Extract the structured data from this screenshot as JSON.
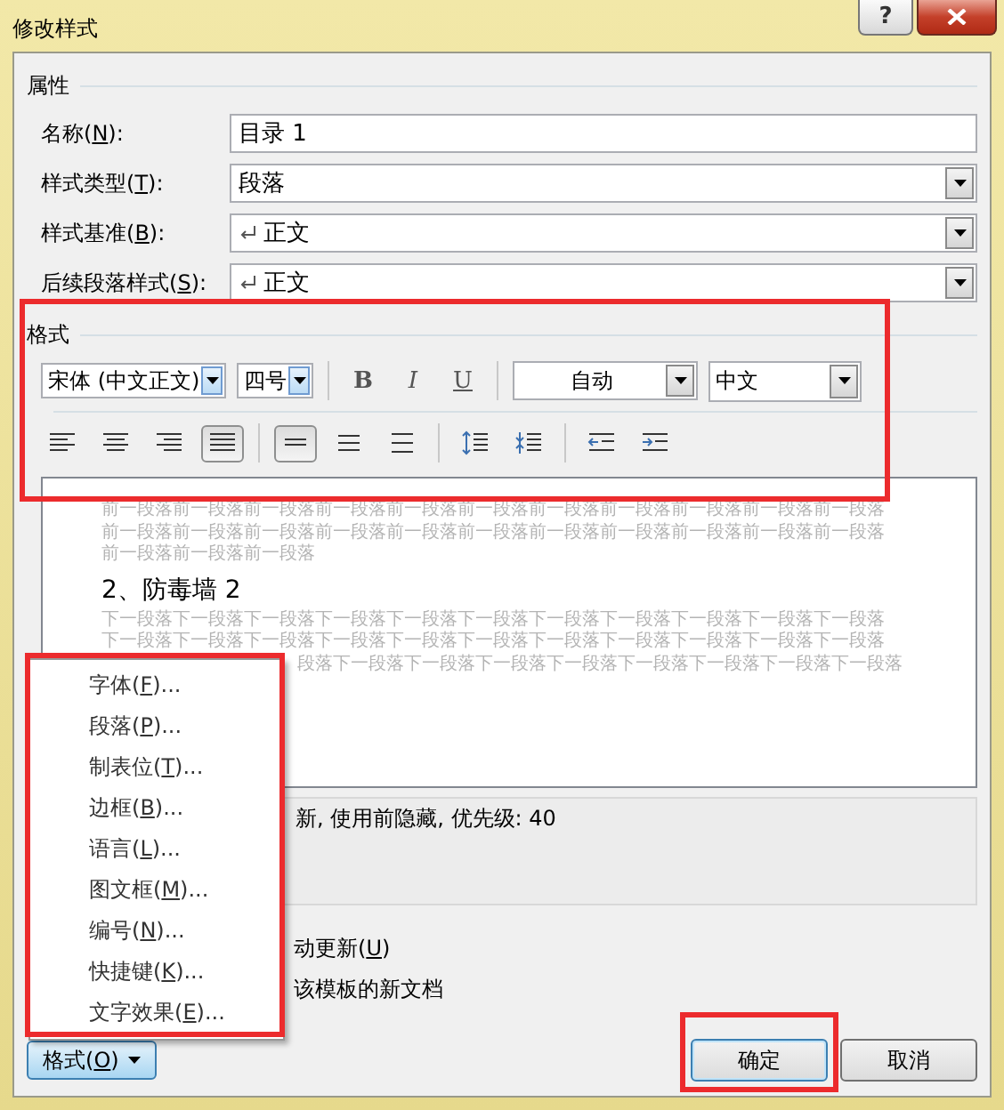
{
  "window": {
    "title": "修改样式",
    "help": "?"
  },
  "properties": {
    "heading": "属性",
    "fields": [
      {
        "kind": "text",
        "label": "名称(N):",
        "value": "目录 1"
      },
      {
        "kind": "select",
        "label": "样式类型(T):",
        "value": "段落",
        "pilcrow": false
      },
      {
        "kind": "select",
        "label": "样式基准(B):",
        "value": "正文",
        "pilcrow": true
      },
      {
        "kind": "select",
        "label": "后续段落样式(S):",
        "value": "正文",
        "pilcrow": true
      }
    ]
  },
  "format": {
    "heading": "格式",
    "font": "宋体 (中文正文)",
    "size": "四号",
    "styles": [
      {
        "kind": "bold",
        "text": "B"
      },
      {
        "kind": "italic",
        "text": "I"
      },
      {
        "kind": "underline",
        "text": "U"
      }
    ],
    "text_paint": "自动",
    "language": "中文",
    "paragraph_tools": [
      {
        "kind": "align-left",
        "selected": false
      },
      {
        "kind": "align-center",
        "selected": false
      },
      {
        "kind": "align-right",
        "selected": false
      },
      {
        "kind": "justify",
        "selected": true
      },
      {
        "kind": "single-spacing",
        "selected": true
      },
      {
        "kind": "one-half-spacing",
        "selected": false
      },
      {
        "kind": "double-spacing",
        "selected": false
      },
      {
        "kind": "space-increase",
        "selected": false
      },
      {
        "kind": "space-decrease",
        "selected": false
      },
      {
        "kind": "indent-decrease",
        "selected": false
      },
      {
        "kind": "indent-increase",
        "selected": false
      }
    ]
  },
  "preview": {
    "previous_lines": [
      "前一段落前一段落前一段落前一段落前一段落前一段落前一段落前一段落前一段落前一段落前一段落",
      "前一段落前一段落前一段落前一段落前一段落前一段落前一段落前一段落前一段落前一段落前一段落",
      "前一段落前一段落前一段落"
    ],
    "sample": "2、防毒墙 2",
    "next_lines": [
      "下一段落下一段落下一段落下一段落下一段落下一段落下一段落下一段落下一段落下一段落下一段落",
      "下一段落下一段落下一段落下一段落下一段落下一段落下一段落下一段落下一段落下一段落下一段落",
      "段落下一段落下一段落下一段落下一段落下一段落下一段落下一段落下一段落"
    ]
  },
  "description": "新, 使用前隐藏, 优先级: 40",
  "options": [
    "动更新(U)",
    "该模板的新文档"
  ],
  "format_button": "格式(O)",
  "format_menu": [
    "字体(F)...",
    "段落(P)...",
    "制表位(T)...",
    "边框(B)...",
    "语言(L)...",
    "图文框(M)...",
    "编号(N)...",
    "快捷键(K)...",
    "文字效果(E)..."
  ],
  "buttons": [
    {
      "kind": "ok",
      "label": "确定"
    },
    {
      "kind": "cancel",
      "label": "取消"
    }
  ]
}
